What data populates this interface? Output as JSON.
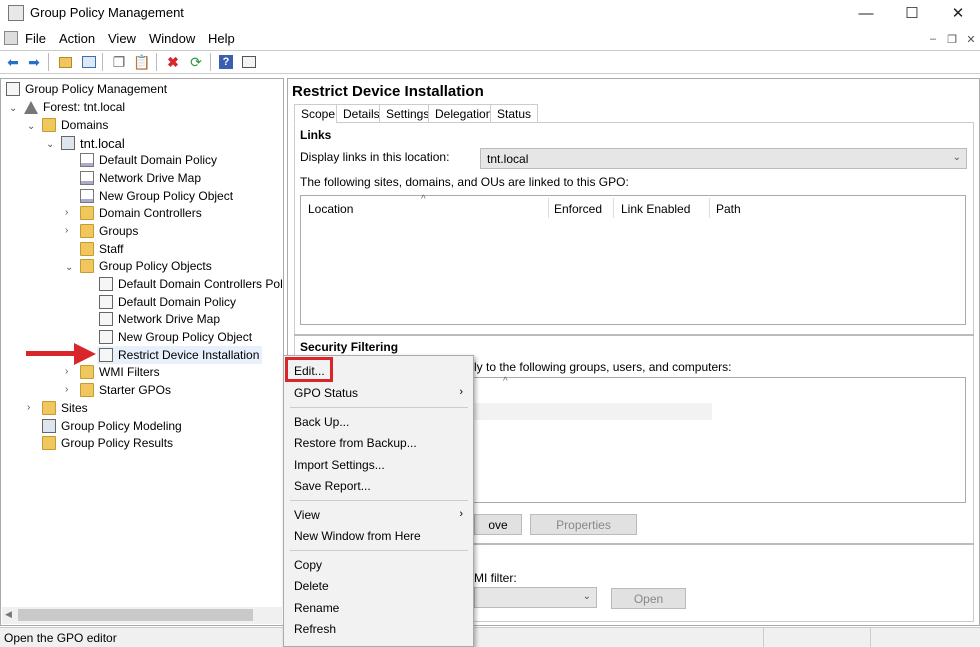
{
  "window": {
    "title": "Group Policy Management",
    "minimize": "—",
    "maximize": "☐",
    "close": "✕"
  },
  "menu": {
    "items": [
      "File",
      "Action",
      "View",
      "Window",
      "Help"
    ],
    "mdi_minimize": "–",
    "mdi_restore": "❐",
    "mdi_close": "✕"
  },
  "tree": {
    "root": "Group Policy Management",
    "forest": "Forest: tnt.local",
    "domains": "Domains",
    "domain": "tnt.local",
    "linked": [
      "Default Domain Policy",
      "Network Drive Map",
      "New Group Policy Object"
    ],
    "domain_controllers": "Domain Controllers",
    "groups": "Groups",
    "staff": "Staff",
    "gpo_container": "Group Policy Objects",
    "gpos": [
      "Default Domain Controllers Policy",
      "Default Domain Policy",
      "Network Drive Map",
      "New Group Policy Object",
      "Restrict Device Installation"
    ],
    "wmi_filters": "WMI Filters",
    "starter_gpos": "Starter GPOs",
    "sites": "Sites",
    "modeling": "Group Policy Modeling",
    "results": "Group Policy Results"
  },
  "detail": {
    "title": "Restrict Device Installation",
    "tabs": [
      "Scope",
      "Details",
      "Settings",
      "Delegation",
      "Status"
    ],
    "links_heading": "Links",
    "display_links_label": "Display links in this location:",
    "display_links_value": "tnt.local",
    "linked_text": "The following sites, domains, and OUs are linked to this GPO:",
    "columns": [
      "Location",
      "Enforced",
      "Link Enabled",
      "Path"
    ],
    "security_heading": "Security Filtering",
    "security_text": "ly to the following groups, users, and computers:",
    "remove_button": "ove",
    "properties_button": "Properties",
    "wmi_label": "MI filter:",
    "open_button": "Open"
  },
  "context_menu": {
    "edit": "Edit...",
    "gpo_status": "GPO Status",
    "back_up": "Back Up...",
    "restore": "Restore from Backup...",
    "import": "Import Settings...",
    "save_report": "Save Report...",
    "view": "View",
    "new_window": "New Window from Here",
    "copy": "Copy",
    "delete": "Delete",
    "rename": "Rename",
    "refresh": "Refresh"
  },
  "status": {
    "text": "Open the GPO editor"
  },
  "colors": {
    "highlight": "#d8262b",
    "selected_row": "#e8f0fb"
  }
}
